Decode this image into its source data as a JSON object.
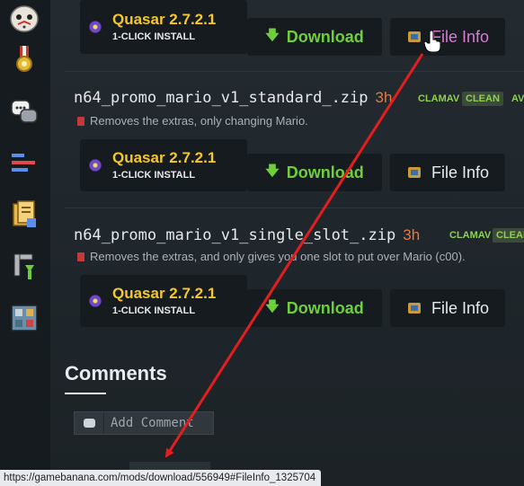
{
  "sidebar": {
    "icons": [
      "jason-mask-icon",
      "medal-icon",
      "chat-bubbles-icon",
      "bars-icon",
      "documents-icon",
      "tools-icon",
      "map-grid-icon"
    ]
  },
  "files": [
    {
      "quasar_title": "Quasar 2.7.2.1",
      "quasar_sub": "1-CLICK INSTALL",
      "download_label": "Download",
      "fileinfo_label": "File Info"
    },
    {
      "name": "n64_promo_mario_v1_standard_.zip",
      "age": "3h",
      "av": "CLAMAV",
      "clean": "CLEAN",
      "av2": "AV",
      "description": "Removes the extras, only changing Mario.",
      "quasar_title": "Quasar 2.7.2.1",
      "quasar_sub": "1-CLICK INSTALL",
      "download_label": "Download",
      "fileinfo_label": "File Info"
    },
    {
      "name": "n64_promo_mario_v1_single_slot_.zip",
      "age": "3h",
      "av": "CLAMAV",
      "clean": "CLEAN",
      "description": "Removes the extras, and only gives you one slot to put over Mario (c00).",
      "quasar_title": "Quasar 2.7.2.1",
      "quasar_sub": "1-CLICK INSTALL",
      "download_label": "Download",
      "fileinfo_label": "File Info"
    }
  ],
  "comments": {
    "title": "Comments",
    "add_label": "Add Comment"
  },
  "status_url": "https://gamebanana.com/mods/download/556949#FileInfo_1325704",
  "colors": {
    "annotation_arrow": "#e41e1e",
    "download_green": "#6fcf3a",
    "quasar_yellow": "#f4c82a",
    "age_orange": "#e7793f"
  }
}
